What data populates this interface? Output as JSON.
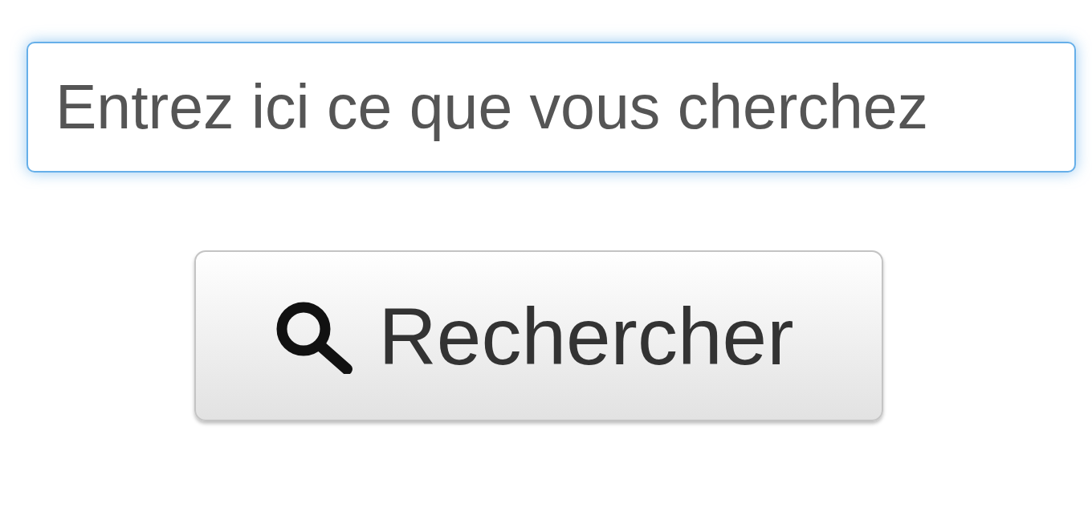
{
  "search": {
    "placeholder": "Entrez ici ce que vous cherchez",
    "focused": true
  },
  "buttons": [
    {
      "kind": "search",
      "label": "Rechercher"
    }
  ]
}
